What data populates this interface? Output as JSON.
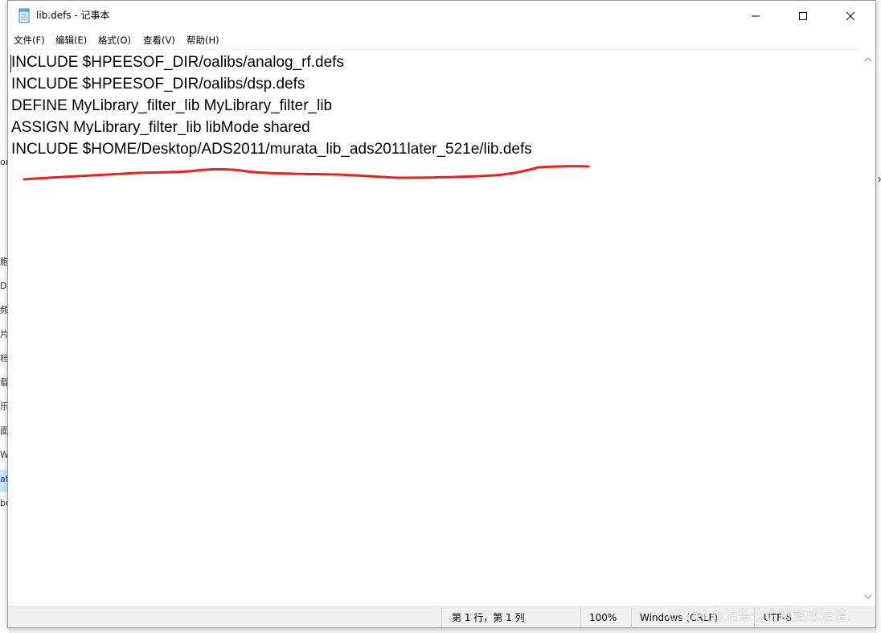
{
  "window": {
    "title": "lib.defs - 记事本"
  },
  "menu": {
    "items": [
      {
        "label": "文件(F)"
      },
      {
        "label": "编辑(E)"
      },
      {
        "label": "格式(O)"
      },
      {
        "label": "查看(V)"
      },
      {
        "label": "帮助(H)"
      }
    ]
  },
  "editor": {
    "lines": [
      "INCLUDE $HPEESOF_DIR/oalibs/analog_rf.defs",
      "INCLUDE $HPEESOF_DIR/oalibs/dsp.defs",
      "DEFINE MyLibrary_filter_lib MyLibrary_filter_lib",
      "ASSIGN MyLibrary_filter_lib libMode shared",
      "INCLUDE $HOME/Desktop/ADS2011/murata_lib_ads2011later_521e/lib.defs"
    ],
    "annotation_color": "#e8231b"
  },
  "status": {
    "position": "第 1 行，第 1 列",
    "zoom": "100%",
    "line_ending": "Windows (CRLF)",
    "encoding": "UTF-8"
  },
  "watermark": "CSDN @油条也会被熬成油渣.",
  "background_window": {
    "fragments": [
      "ora",
      "胞",
      "D",
      "频",
      "片",
      "档",
      "载",
      "乐",
      "面",
      "Win",
      "at",
      "bu"
    ]
  },
  "colors": {
    "window_bg": "#ffffff",
    "statusbar_bg": "#f0f0f0",
    "text": "#000000"
  }
}
